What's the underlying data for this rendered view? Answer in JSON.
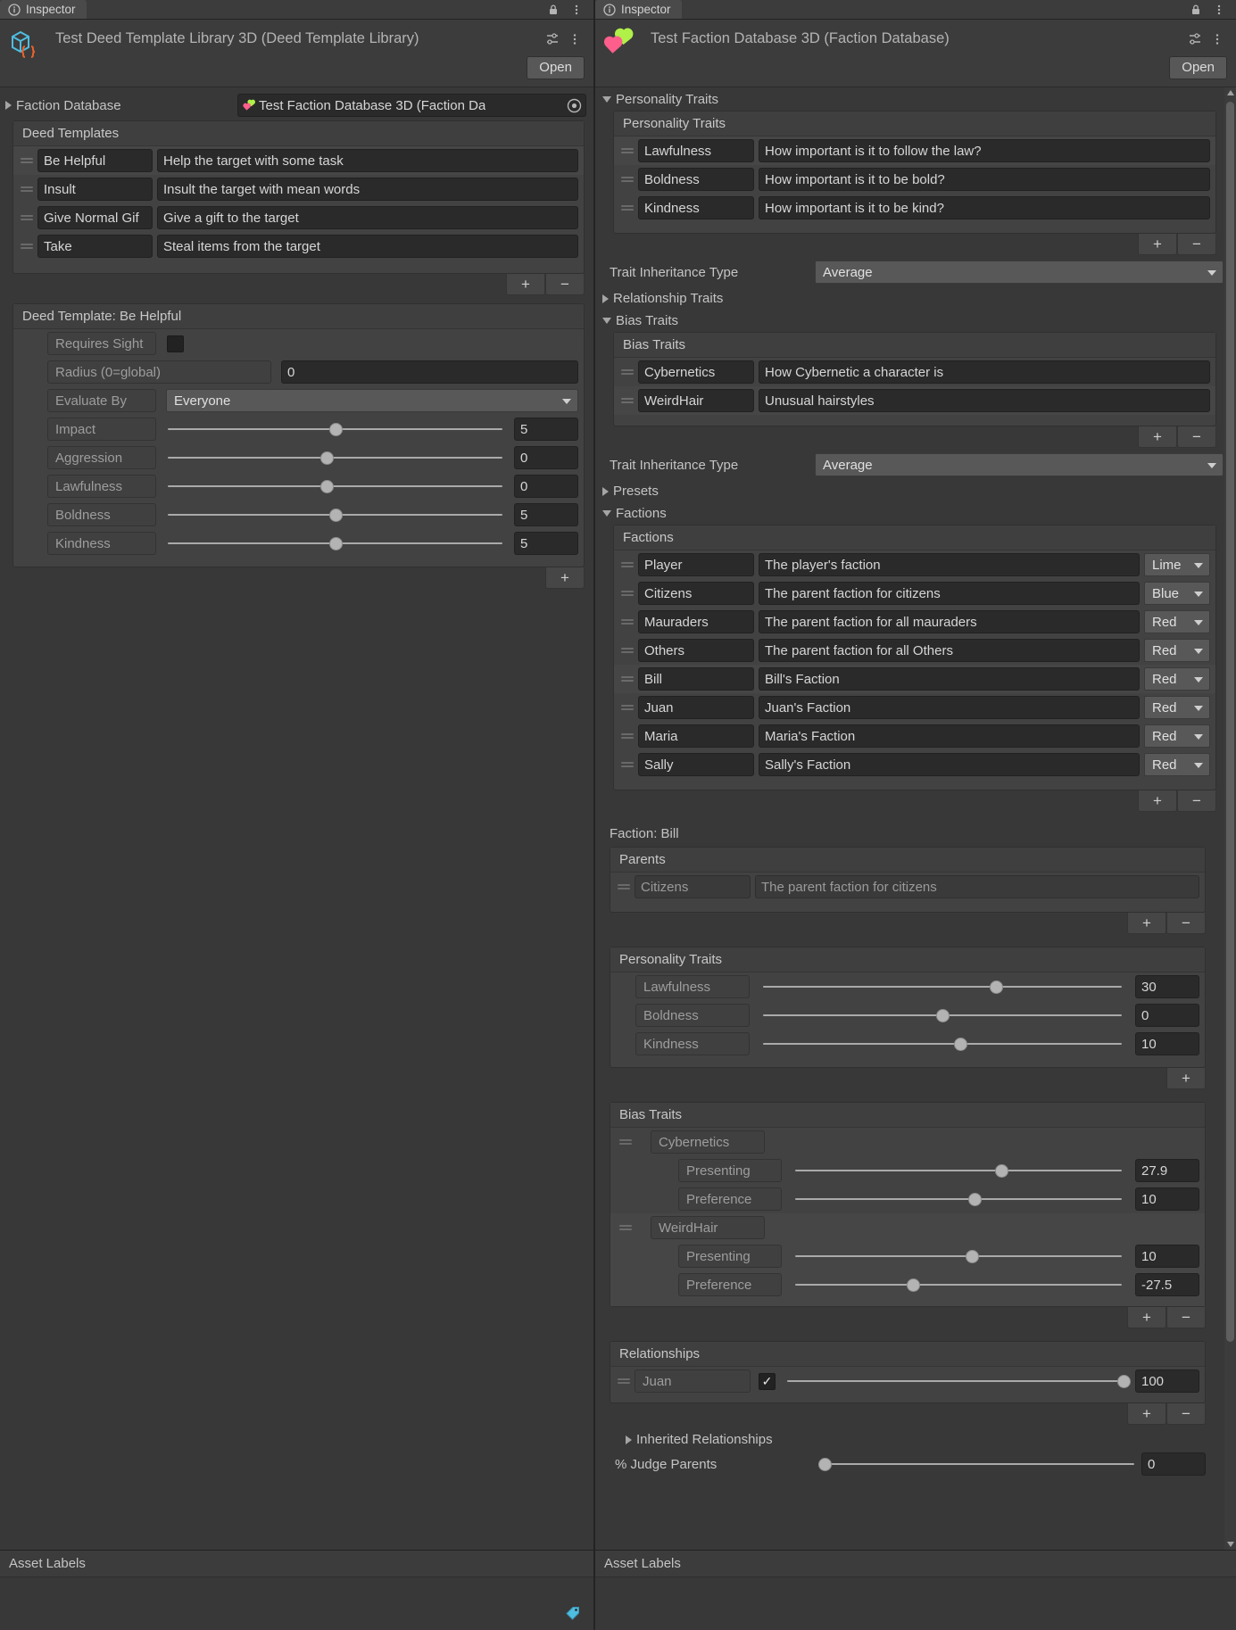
{
  "left_panel": {
    "tab": {
      "label": "Inspector",
      "info_icon": "info-icon",
      "lock_icon": "lock-icon",
      "menu_icon": "kebab-menu-icon"
    },
    "asset": {
      "title": "Test Deed Template Library 3D (Deed Template Library)",
      "icon": "scriptable-object-icon",
      "open_label": "Open",
      "settings_icon": "preset-icon",
      "menu_icon": "kebab-menu-icon"
    },
    "faction_database_field": {
      "label": "Faction Database",
      "value": "Test Faction Database 3D (Faction Da",
      "object_icon": "hearts-icon",
      "picker_icon": "object-picker-icon",
      "expanded": false
    },
    "deed_templates": {
      "header": "Deed Templates",
      "rows": [
        {
          "name": "Be Helpful",
          "description": "Help the target with some task"
        },
        {
          "name": "Insult",
          "description": "Insult the target with mean words"
        },
        {
          "name": "Give Normal Gif",
          "description": "Give a gift to the target"
        },
        {
          "name": "Take",
          "description": "Steal items from the target"
        }
      ],
      "add_label": "+",
      "remove_label": "−"
    },
    "deed_template_detail": {
      "header": "Deed Template: Be Helpful",
      "requires_sight": {
        "label": "Requires Sight",
        "checked": false
      },
      "radius": {
        "label": "Radius (0=global)",
        "value": "0"
      },
      "evaluate_by": {
        "label": "Evaluate By",
        "value": "Everyone"
      },
      "sliders": [
        {
          "label": "Impact",
          "value": "5",
          "pct": 50
        },
        {
          "label": "Aggression",
          "value": "0",
          "pct": 47.5
        },
        {
          "label": "Lawfulness",
          "value": "0",
          "pct": 47.5
        },
        {
          "label": "Boldness",
          "value": "5",
          "pct": 50
        },
        {
          "label": "Kindness",
          "value": "5",
          "pct": 50
        }
      ],
      "add_label": "+"
    }
  },
  "right_panel": {
    "tab": {
      "label": "Inspector",
      "info_icon": "info-icon",
      "lock_icon": "lock-icon",
      "menu_icon": "kebab-menu-icon"
    },
    "asset": {
      "title": "Test Faction Database 3D (Faction Database)",
      "icon": "hearts-icon",
      "open_label": "Open",
      "settings_icon": "preset-icon",
      "menu_icon": "kebab-menu-icon"
    },
    "personality_traits_foldout": {
      "label": "Personality Traits",
      "expanded": true
    },
    "personality_traits_list": {
      "header": "Personality Traits",
      "rows": [
        {
          "name": "Lawfulness",
          "description": "How important is it to follow the law?"
        },
        {
          "name": "Boldness",
          "description": "How important is it to be bold?"
        },
        {
          "name": "Kindness",
          "description": "How important is it to be kind?"
        }
      ],
      "add_label": "+",
      "remove_label": "−"
    },
    "trait_inheritance_1": {
      "label": "Trait Inheritance Type",
      "value": "Average"
    },
    "relationship_traits_foldout": {
      "label": "Relationship Traits",
      "expanded": false
    },
    "bias_traits_foldout": {
      "label": "Bias Traits",
      "expanded": true
    },
    "bias_traits_list": {
      "header": "Bias Traits",
      "rows": [
        {
          "name": "Cybernetics",
          "description": "How Cybernetic a character is"
        },
        {
          "name": "WeirdHair",
          "description": "Unusual hairstyles"
        }
      ],
      "add_label": "+",
      "remove_label": "−"
    },
    "trait_inheritance_2": {
      "label": "Trait Inheritance Type",
      "value": "Average"
    },
    "presets_foldout": {
      "label": "Presets",
      "expanded": false
    },
    "factions_foldout": {
      "label": "Factions",
      "expanded": true
    },
    "factions_list": {
      "header": "Factions",
      "rows": [
        {
          "name": "Player",
          "description": "The player's faction",
          "color": "Lime"
        },
        {
          "name": "Citizens",
          "description": "The parent faction for citizens",
          "color": "Blue"
        },
        {
          "name": "Mauraders",
          "description": "The parent faction for all mauraders",
          "color": "Red"
        },
        {
          "name": "Others",
          "description": "The parent faction for all Others",
          "color": "Red"
        },
        {
          "name": "Bill",
          "description": "Bill's Faction",
          "color": "Red"
        },
        {
          "name": "Juan",
          "description": "Juan's Faction",
          "color": "Red"
        },
        {
          "name": "Maria",
          "description": "Maria's Faction",
          "color": "Red"
        },
        {
          "name": "Sally",
          "description": "Sally's Faction",
          "color": "Red"
        }
      ],
      "add_label": "+",
      "remove_label": "−"
    },
    "faction_detail": {
      "header": "Faction: Bill",
      "parents": {
        "header": "Parents",
        "rows": [
          {
            "name": "Citizens",
            "description": "The parent faction for citizens"
          }
        ],
        "add_label": "+",
        "remove_label": "−"
      },
      "personality_traits": {
        "header": "Personality Traits",
        "rows": [
          {
            "label": "Lawfulness",
            "value": "30",
            "pct": 65
          },
          {
            "label": "Boldness",
            "value": "0",
            "pct": 50
          },
          {
            "label": "Kindness",
            "value": "10",
            "pct": 55
          }
        ],
        "add_label": "+"
      },
      "bias_traits": {
        "header": "Bias Traits",
        "groups": [
          {
            "name": "Cybernetics",
            "rows": [
              {
                "label": "Presenting",
                "value": "27.9",
                "pct": 63
              },
              {
                "label": "Preference",
                "value": "10",
                "pct": 55
              }
            ]
          },
          {
            "name": "WeirdHair",
            "rows": [
              {
                "label": "Presenting",
                "value": "10",
                "pct": 54
              },
              {
                "label": "Preference",
                "value": "-27.5",
                "pct": 36
              }
            ]
          }
        ],
        "add_label": "+",
        "remove_label": "−"
      },
      "relationships": {
        "header": "Relationships",
        "rows": [
          {
            "name": "Juan",
            "checked": true,
            "value": "100",
            "pct": 100
          }
        ],
        "add_label": "+",
        "remove_label": "−"
      },
      "inherited_relationships_foldout": {
        "label": "Inherited Relationships",
        "expanded": false
      },
      "judge_parents": {
        "label": "% Judge Parents",
        "value": "0",
        "pct": 2
      }
    }
  },
  "footers": {
    "left": {
      "title": "Asset Labels",
      "tag_icon": "label-tag-icon"
    },
    "right": {
      "title": "Asset Labels"
    }
  },
  "colors": {
    "panel_bg": "#383838",
    "header_bg": "#3c3c3c",
    "field_bg": "#2a2a2a",
    "popup_bg": "#585858",
    "accent_lime": "#b0f048",
    "accent_pink": "#fd5e8c",
    "icon_blue": "#4fbde0",
    "icon_orange": "#e8622d"
  }
}
